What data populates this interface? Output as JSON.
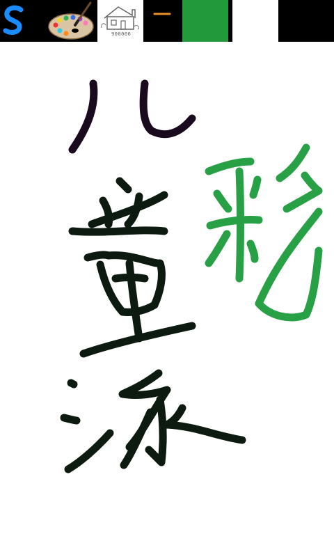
{
  "toolbar": {
    "tools": [
      {
        "id": "brush",
        "icon": "brush-s-icon",
        "color": "#1a8cff"
      },
      {
        "id": "palette",
        "icon": "paint-palette-icon"
      },
      {
        "id": "coloring-page",
        "icon": "house-outline-icon",
        "code": "900006"
      },
      {
        "id": "brush-size",
        "icon": "line-width-icon",
        "color": "#e8902a"
      },
      {
        "id": "current-color",
        "icon": "color-swatch-icon",
        "color": "#229a3c"
      },
      {
        "id": "eraser",
        "icon": "white-swatch-icon",
        "color": "#ffffff"
      },
      {
        "id": "clear",
        "icon": "black-swatch-icon",
        "color": "#000000"
      }
    ]
  },
  "canvas": {
    "background": "#ffffff",
    "ink_colors": {
      "dark": "#0c1a10",
      "purple_black": "#1a0a1e",
      "green": "#28a045"
    }
  }
}
